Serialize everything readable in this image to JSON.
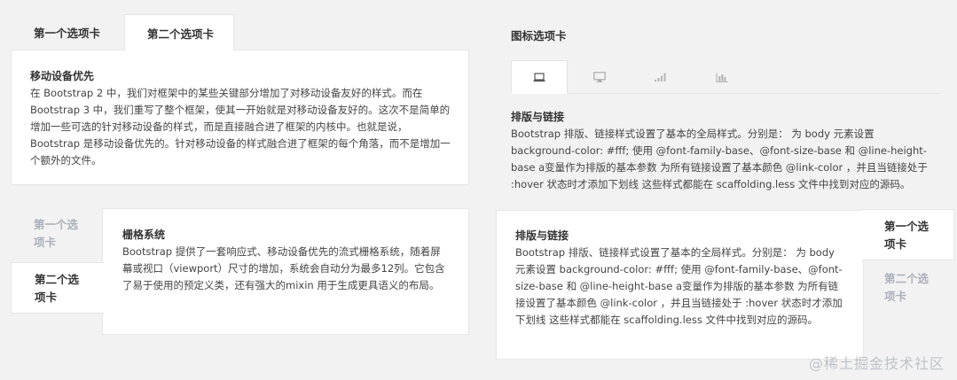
{
  "block1": {
    "tabs": [
      "第一个选项卡",
      "第二个选项卡"
    ],
    "title": "移动设备优先",
    "text": "在 Bootstrap 2 中，我们对框架中的某些关键部分增加了对移动设备友好的样式。而在 Bootstrap 3 中，我们重写了整个框架，使其一开始就是对移动设备友好的。这次不是简单的增加一些可选的针对移动设备的样式，而是直接融合进了框架的内核中。也就是说，Bootstrap 是移动设备优先的。针对移动设备的样式融合进了框架的每个角落，而不是增加一个额外的文件。"
  },
  "block2": {
    "heading": "图标选项卡",
    "icons": [
      "laptop-icon",
      "desktop-icon",
      "signal-icon",
      "bar-chart-icon"
    ],
    "title": "排版与链接",
    "text": "Bootstrap 排版、链接样式设置了基本的全局样式。分别是： 为 body 元素设置 background-color: #fff; 使用 @font-family-base、@font-size-base 和 @line-height-base a变量作为排版的基本参数 为所有链接设置了基本颜色 @link-color ，并且当链接处于 :hover 状态时才添加下划线 这些样式都能在 scaffolding.less 文件中找到对应的源码。"
  },
  "block3": {
    "tabs": [
      "第一个选项卡",
      "第二个选项卡"
    ],
    "title": "栅格系统",
    "text": "Bootstrap 提供了一套响应式、移动设备优先的流式栅格系统，随着屏幕或视口（viewport）尺寸的增加，系统会自动分为最多12列。它包含了易于使用的预定义类，还有强大的mixin 用于生成更具语义的布局。"
  },
  "block4": {
    "tabs": [
      "第一个选项卡",
      "第二个选项卡"
    ],
    "title": "排版与链接",
    "text": "Bootstrap 排版、链接样式设置了基本的全局样式。分别是： 为 body 元素设置 background-color: #fff; 使用 @font-family-base、@font-size-base 和 @line-height-base a变量作为排版的基本参数 为所有链接设置了基本颜色 @link-color ，并且当链接处于 :hover 状态时才添加下划线 这些样式都能在 scaffolding.less 文件中找到对应的源码。"
  },
  "watermark": "@稀土掘金技术社区"
}
